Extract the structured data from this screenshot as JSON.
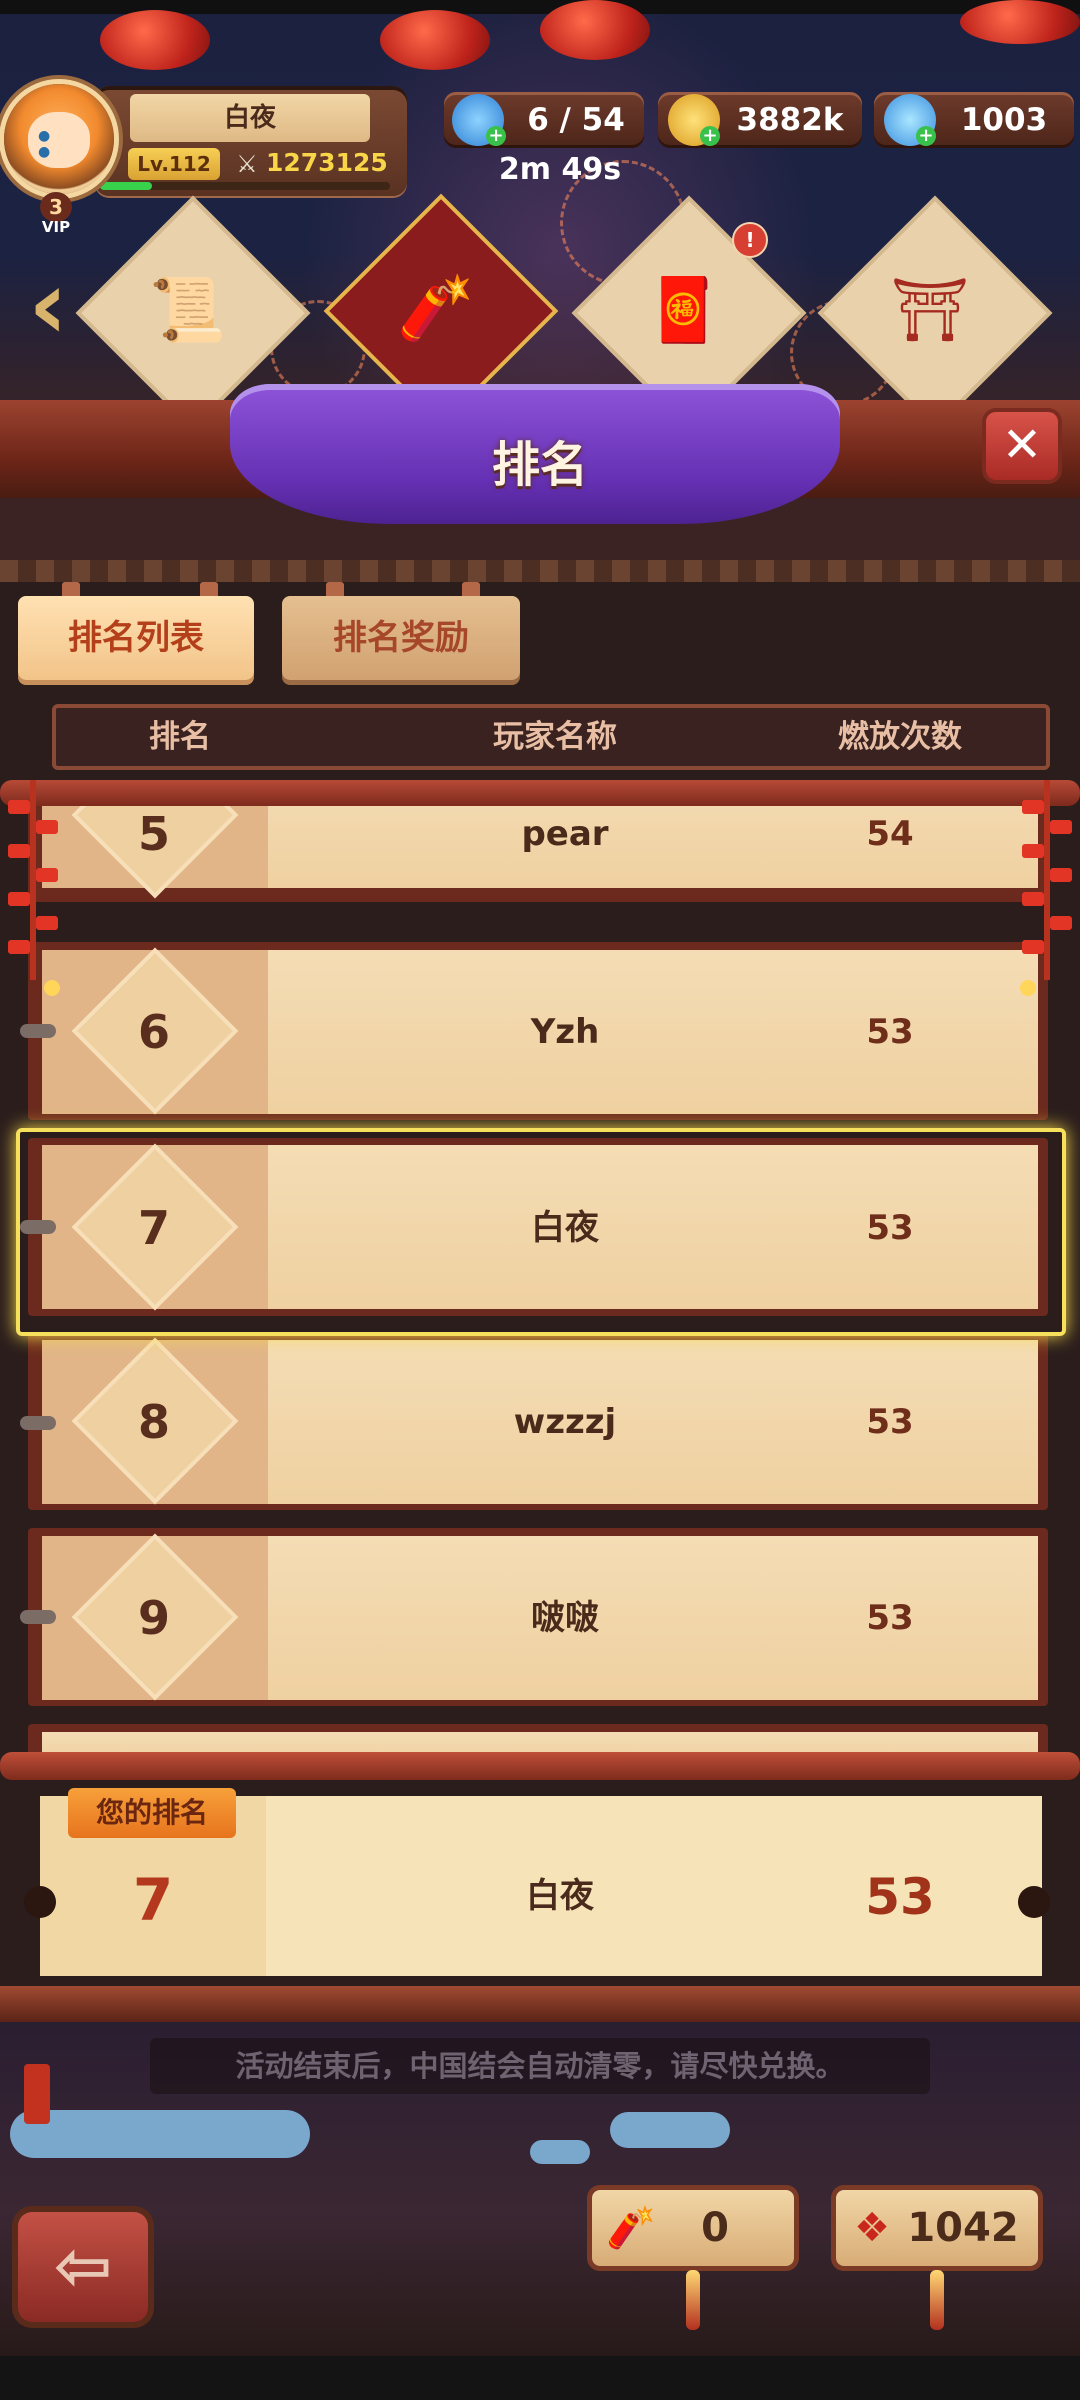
{
  "player": {
    "name": "白夜",
    "level": "Lv.112",
    "power": "1273125",
    "vip": "3",
    "vip_label": "VIP",
    "xp_fraction": 0.18
  },
  "resources": {
    "stars": "6 / 54",
    "coins": "3882k",
    "gems": "1003",
    "timer": "2m 49s"
  },
  "events": {
    "icons": [
      "scroll-icon",
      "firecracker-icon",
      "gift-bag-icon",
      "temple-gate-icon"
    ],
    "notify_count": "!"
  },
  "banner": {
    "title": "排名",
    "close": "✕"
  },
  "tabs": [
    {
      "label": "排名列表",
      "active": true
    },
    {
      "label": "排名奖励",
      "active": false
    }
  ],
  "table": {
    "headers": [
      "排名",
      "玩家名称",
      "燃放次数"
    ],
    "rows": [
      {
        "rank": "5",
        "name": "pear",
        "count": "54"
      },
      {
        "rank": "6",
        "name": "Yzh",
        "count": "53"
      },
      {
        "rank": "7",
        "name": "白夜",
        "count": "53"
      },
      {
        "rank": "8",
        "name": "wzzzj",
        "count": "53"
      },
      {
        "rank": "9",
        "name": "啵啵",
        "count": "53"
      }
    ]
  },
  "my_rank": {
    "tag": "您的排名",
    "rank": "7",
    "name": "白夜",
    "count": "53"
  },
  "footer": {
    "notice": "活动结束后，中国结会自动清零，请尽快兑换。",
    "firecracker_count": "0",
    "knot_count": "1042",
    "back": "⇦"
  },
  "colors": {
    "accent": "#e6b64d",
    "banner": "#7a42c8",
    "highlight": "#f7e05b"
  }
}
